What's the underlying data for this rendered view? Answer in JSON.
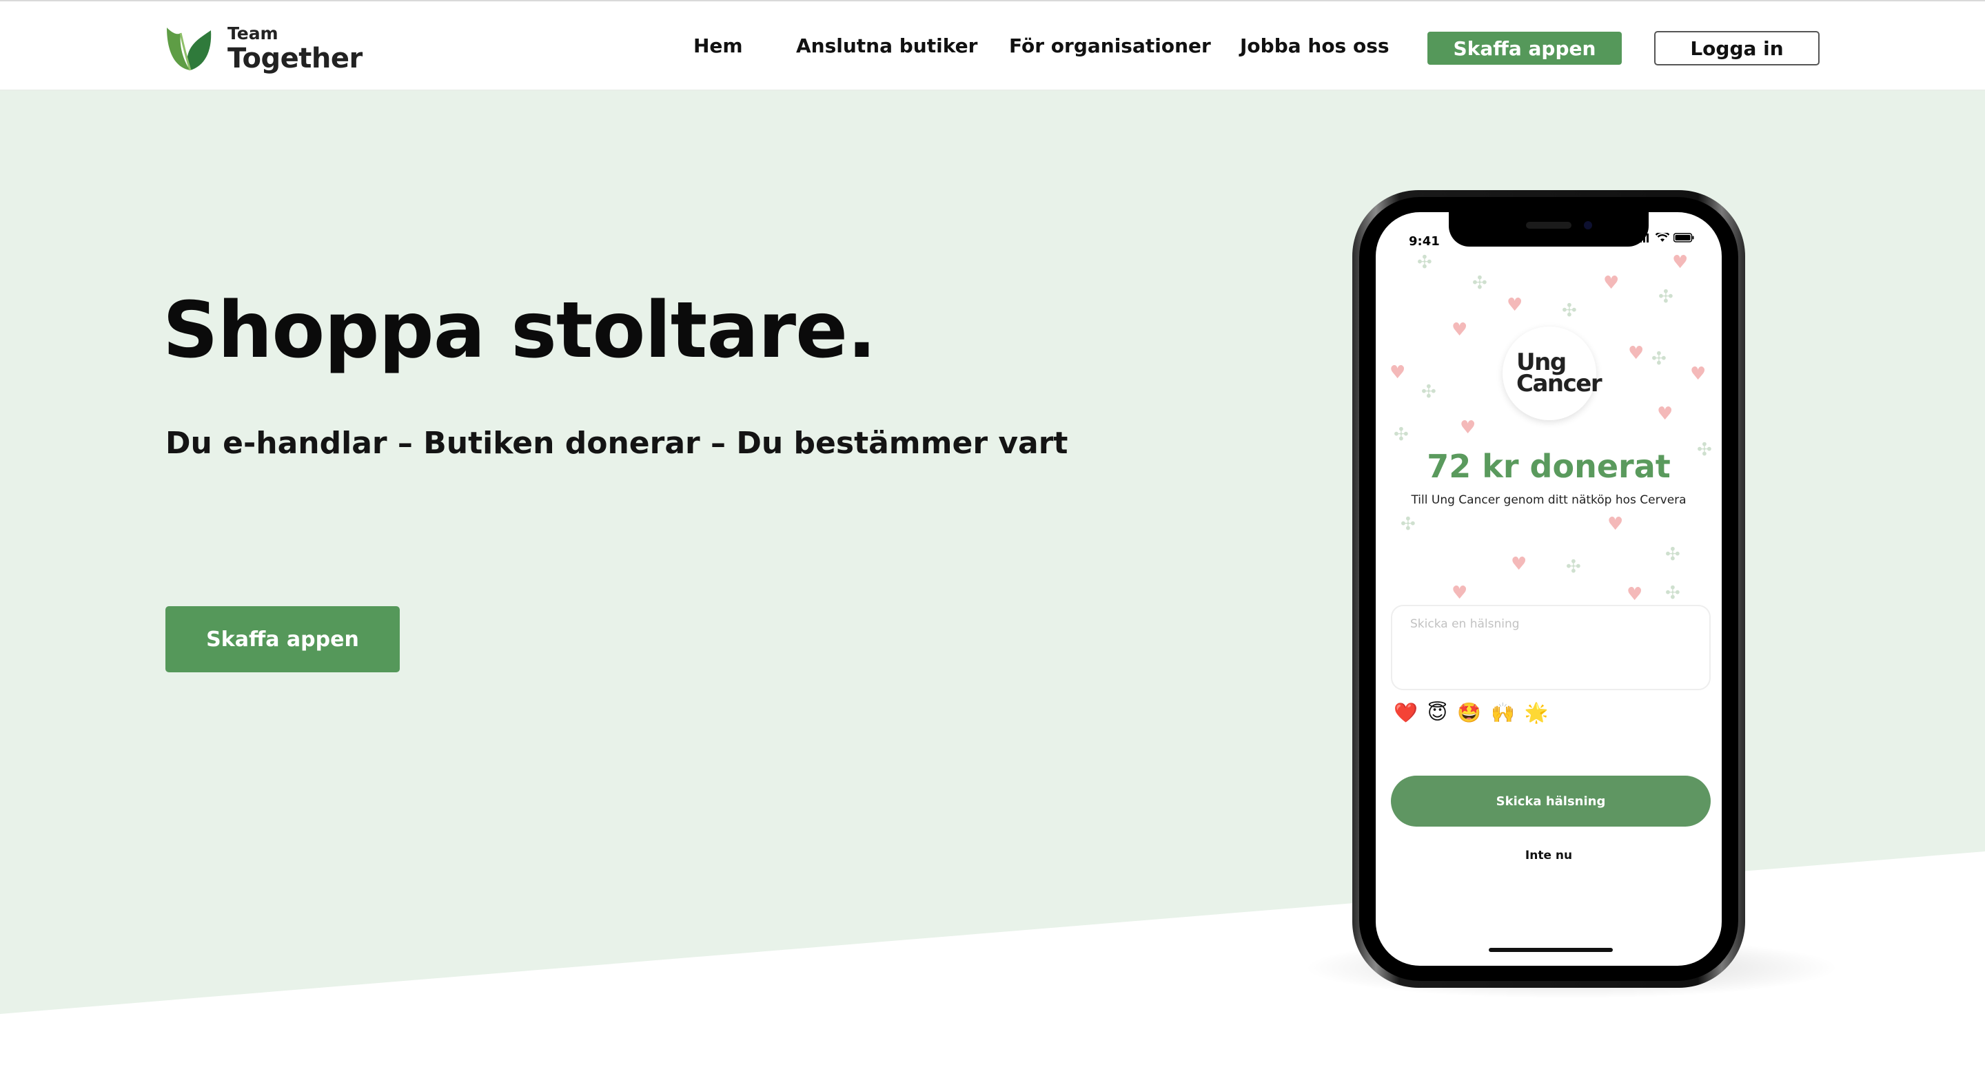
{
  "header": {
    "logo": {
      "line1": "Team",
      "line2": "Together"
    },
    "nav": [
      {
        "label": "Hem"
      },
      {
        "label": "Anslutna butiker"
      },
      {
        "label": "För organisationer"
      },
      {
        "label": "Jobba hos oss"
      }
    ],
    "cta_label": "Skaffa appen",
    "login_label": "Logga in"
  },
  "hero": {
    "title": "Shoppa stoltare.",
    "subtitle": "Du e-handlar – Butiken donerar – Du bestämmer vart",
    "button_label": "Skaffa appen"
  },
  "phone": {
    "time": "9:41",
    "org_line1": "Ung",
    "org_line2": "Cancer",
    "donated_text": "72 kr donerat",
    "donated_sub": "Till Ung Cancer genom ditt nätköp hos Cervera",
    "greeting_placeholder": "Skicka en hälsning",
    "emojis": [
      "❤️",
      "😇",
      "🤩",
      "🙌",
      "🌟"
    ],
    "send_label": "Skicka hälsning",
    "skip_label": "Inte nu"
  },
  "colors": {
    "brand_green": "#55985a",
    "hero_bg": "#e8f2e9",
    "donated_green": "#5a9a5d"
  }
}
